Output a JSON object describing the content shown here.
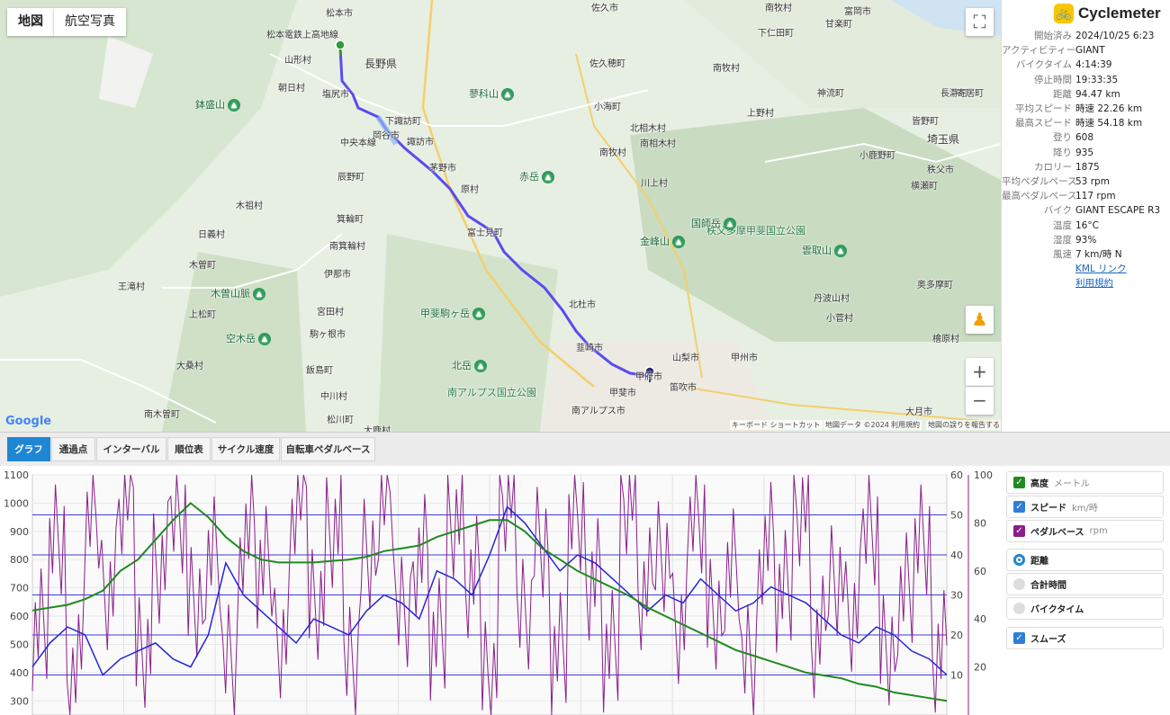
{
  "map": {
    "tabs": [
      "地図",
      "航空写真"
    ],
    "footer": {
      "keyboard": "キーボード ショートカット",
      "mapdata": "地図データ ©2024",
      "terms": "利用規約",
      "report": "地図の誤りを報告する"
    },
    "google": "Google",
    "labels": [
      {
        "t": "松本市"
      },
      {
        "t": "長野県",
        "big": true
      },
      {
        "t": "塩尻市"
      },
      {
        "t": "岡谷市"
      },
      {
        "t": "下諏訪町"
      },
      {
        "t": "諏訪市"
      },
      {
        "t": "茅野市"
      },
      {
        "t": "原村"
      },
      {
        "t": "富士見町"
      },
      {
        "t": "北杜市"
      },
      {
        "t": "韮崎市"
      },
      {
        "t": "甲府市"
      },
      {
        "t": "甲斐市"
      },
      {
        "t": "笛吹市"
      },
      {
        "t": "山梨市"
      },
      {
        "t": "甲州市"
      },
      {
        "t": "南アルプス市"
      },
      {
        "t": "辰野町"
      },
      {
        "t": "箕輪町"
      },
      {
        "t": "南箕輪村"
      },
      {
        "t": "伊那市"
      },
      {
        "t": "宮田村"
      },
      {
        "t": "駒ヶ根市"
      },
      {
        "t": "飯島町"
      },
      {
        "t": "中川村"
      },
      {
        "t": "松川町"
      },
      {
        "t": "大鹿村"
      },
      {
        "t": "木曽町"
      },
      {
        "t": "木祖村"
      },
      {
        "t": "王滝村"
      },
      {
        "t": "上松町"
      },
      {
        "t": "大桑村"
      },
      {
        "t": "南木曽町"
      },
      {
        "t": "山形村"
      },
      {
        "t": "朝日村"
      },
      {
        "t": "佐久市"
      },
      {
        "t": "佐久穂町"
      },
      {
        "t": "小海町"
      },
      {
        "t": "南牧村"
      },
      {
        "t": "北相木村"
      },
      {
        "t": "南相木村"
      },
      {
        "t": "川上村"
      },
      {
        "t": "南牧村"
      },
      {
        "t": "神流町"
      },
      {
        "t": "上野村"
      },
      {
        "t": "小鹿野町"
      },
      {
        "t": "秩父市"
      },
      {
        "t": "横瀬町"
      },
      {
        "t": "埼玉県",
        "big": true
      },
      {
        "t": "皆野町"
      },
      {
        "t": "長瀞町"
      },
      {
        "t": "寄居町"
      },
      {
        "t": "丹波山村"
      },
      {
        "t": "小菅村"
      },
      {
        "t": "奥多摩町"
      },
      {
        "t": "檜原村"
      },
      {
        "t": "大月市"
      },
      {
        "t": "甘楽町"
      },
      {
        "t": "下仁田町"
      },
      {
        "t": "富岡市"
      },
      {
        "t": "南牧村"
      },
      {
        "t": "中央本線"
      },
      {
        "t": "松本電鉄上高地線"
      },
      {
        "t": "日義村"
      },
      {
        "t": "南アルプス国立公園",
        "park": true
      },
      {
        "t": "秩父多摩甲斐国立公園",
        "park": true
      }
    ],
    "mountains": [
      "鉢盛山",
      "蓼科山",
      "赤岳",
      "国師岳",
      "金峰山",
      "雲取山",
      "木曽山脈",
      "空木岳",
      "甲斐駒ヶ岳",
      "北岳"
    ]
  },
  "panel": {
    "brand": "Cyclemeter",
    "stats": [
      {
        "k": "開始済み",
        "v": "2024/10/25 6:23"
      },
      {
        "k": "アクティビティー",
        "v": "GIANT"
      },
      {
        "k": "バイクタイム",
        "v": "4:14:39"
      },
      {
        "k": "停止時間",
        "v": "19:33:35"
      },
      {
        "k": "距離",
        "v": "94.47 km"
      },
      {
        "k": "平均スピード",
        "v": "時速 22.26 km"
      },
      {
        "k": "最高スピード",
        "v": "時速 54.18 km"
      },
      {
        "k": "登り",
        "v": "608"
      },
      {
        "k": "降り",
        "v": "935"
      },
      {
        "k": "カロリー",
        "v": "1875"
      },
      {
        "k": "平均ペダルペース",
        "v": "53 rpm"
      },
      {
        "k": "最高ペダルペース",
        "v": "117 rpm"
      },
      {
        "k": "バイク",
        "v": "GIANT ESCAPE R3"
      },
      {
        "k": "温度",
        "v": "16°C"
      },
      {
        "k": "湿度",
        "v": "93%"
      },
      {
        "k": "風速",
        "v": "7 km/時 N"
      }
    ],
    "links": [
      "KML リンク",
      "利用規約"
    ]
  },
  "tabs": [
    "グラフ",
    "通過点",
    "インターバル",
    "順位表",
    "サイクル速度",
    "自転車ペダルベース"
  ],
  "legend": {
    "series": [
      {
        "label": "高度",
        "unit": "メートル",
        "color": "#1f8a1f"
      },
      {
        "label": "スピード",
        "unit": "km/時",
        "color": "#2f7fd6"
      },
      {
        "label": "ペダルベース",
        "unit": "rpm",
        "color": "#8a1f8a"
      }
    ],
    "axis": [
      {
        "label": "距離",
        "selected": true
      },
      {
        "label": "合計時間",
        "selected": false
      },
      {
        "label": "バイクタイム",
        "selected": false
      }
    ],
    "smooth": "スムーズ"
  },
  "chart_data": {
    "type": "line",
    "left_axis": {
      "ticks": [
        1100,
        1000,
        900,
        800,
        700,
        600,
        500,
        400,
        300
      ]
    },
    "right_axis_speed": {
      "ticks": [
        60,
        50,
        40,
        30,
        20,
        10
      ]
    },
    "right_axis_cadence": {
      "ticks": [
        100,
        80,
        60,
        40,
        20
      ]
    },
    "series": [
      {
        "name": "高度",
        "axis": "left",
        "values": [
          620,
          630,
          640,
          660,
          690,
          760,
          800,
          870,
          940,
          1000,
          950,
          880,
          830,
          800,
          790,
          790,
          790,
          795,
          800,
          810,
          830,
          840,
          850,
          880,
          900,
          920,
          940,
          940,
          900,
          840,
          800,
          760,
          730,
          700,
          670,
          630,
          600,
          570,
          540,
          510,
          480,
          460,
          440,
          420,
          400,
          390,
          380,
          360,
          350,
          330,
          320,
          310,
          300
        ]
      },
      {
        "name": "スピード",
        "axis": "right_speed",
        "values": [
          12,
          18,
          22,
          20,
          10,
          14,
          16,
          18,
          14,
          12,
          20,
          38,
          30,
          26,
          22,
          18,
          24,
          22,
          20,
          26,
          30,
          28,
          24,
          36,
          34,
          30,
          40,
          52,
          48,
          42,
          36,
          40,
          38,
          34,
          30,
          26,
          30,
          28,
          34,
          30,
          26,
          28,
          32,
          30,
          28,
          24,
          20,
          18,
          22,
          20,
          16,
          14,
          10
        ]
      },
      {
        "name": "ペダルベース",
        "axis": "right_cadence",
        "values": [
          40,
          70,
          20,
          80,
          55,
          90,
          30,
          60,
          85,
          45,
          70,
          20,
          80,
          60,
          35,
          90,
          50,
          75,
          25,
          65,
          95,
          40,
          70,
          30,
          85,
          55,
          20,
          90,
          45,
          70,
          30,
          80,
          60,
          25,
          95,
          50,
          70,
          35,
          85,
          40,
          65,
          20,
          75,
          50,
          90,
          30,
          60,
          40,
          80,
          25,
          55,
          70,
          30
        ]
      }
    ]
  }
}
